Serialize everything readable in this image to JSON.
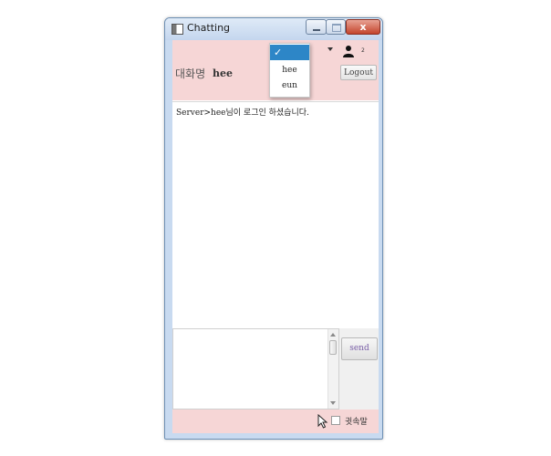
{
  "window": {
    "title": "Chatting",
    "close_glyph": "x"
  },
  "header": {
    "room_label": "대화명",
    "room_name": "hee",
    "user_count": "2",
    "logout_label": "Logout"
  },
  "user_menu": {
    "selected_glyph": "✓",
    "items": [
      "hee",
      "eun"
    ]
  },
  "messages": [
    "Server>hee님이 로그인 하셨습니다."
  ],
  "input": {
    "value": "",
    "send_label": "send"
  },
  "footer": {
    "whisper_label": "귓속말",
    "whisper_checked": false
  },
  "icons": {
    "app": "app-window-icon",
    "user": "user-icon",
    "cursor": "mouse-pointer-icon"
  },
  "colors": {
    "header_bg": "#f6d6d6",
    "footer_bg": "#f6d6d6",
    "menu_selected": "#2d86c7",
    "send_text": "#7a5fa8"
  }
}
